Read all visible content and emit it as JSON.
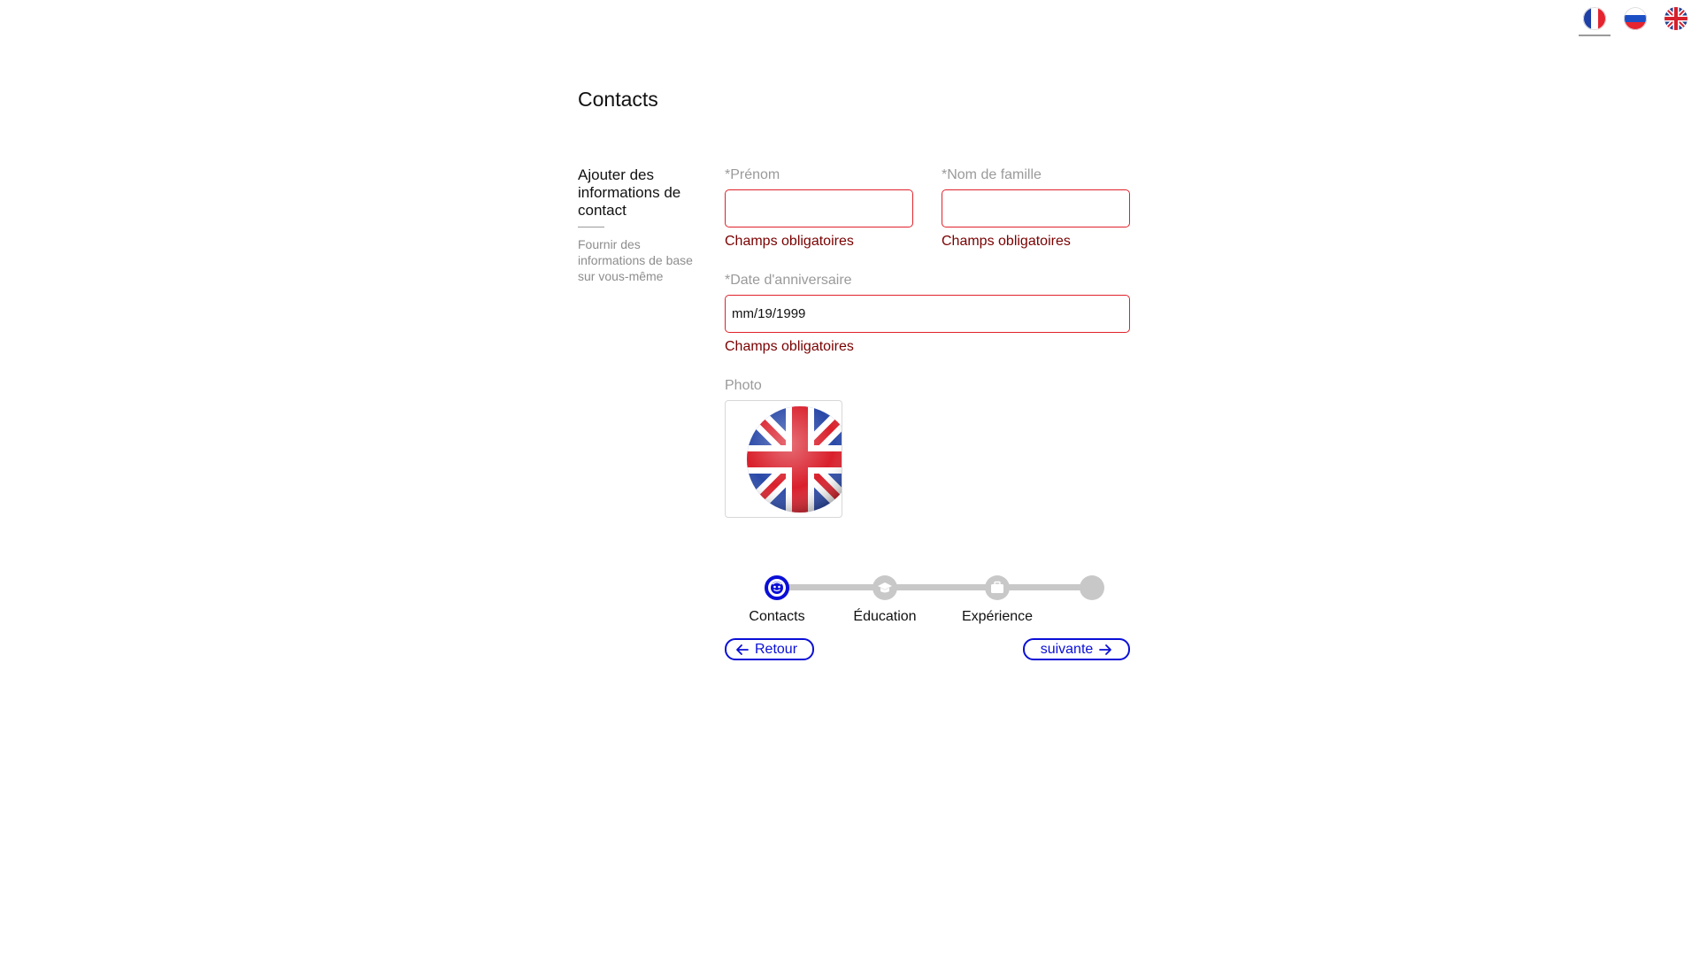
{
  "languages": [
    {
      "code": "fr",
      "icon": "france-flag-icon",
      "active": true
    },
    {
      "code": "ru",
      "icon": "russia-flag-icon",
      "active": false
    },
    {
      "code": "en",
      "icon": "uk-flag-icon",
      "active": false
    }
  ],
  "page": {
    "title": "Contacts"
  },
  "section": {
    "heading": "Ajouter des informations de contact",
    "description": "Fournir des informations de base sur vous-même"
  },
  "form": {
    "first_name": {
      "label": "*Prénom",
      "value": "",
      "error": "Champs obligatoires"
    },
    "last_name": {
      "label": "*Nom de famille",
      "value": "",
      "error": "Champs obligatoires"
    },
    "birthday": {
      "label": "*Date d'anniversaire",
      "value": "mm/19/1999",
      "error": "Champs obligatoires"
    },
    "photo": {
      "label": "Photo",
      "icon": "uk-flag-icon"
    }
  },
  "stepper": {
    "steps": [
      {
        "label": "Contacts",
        "icon": "user-face-icon",
        "active": true
      },
      {
        "label": "Éducation",
        "icon": "graduation-cap-icon",
        "active": false
      },
      {
        "label": "Expérience",
        "icon": "briefcase-icon",
        "active": false
      },
      {
        "label": "",
        "icon": "",
        "active": false
      }
    ]
  },
  "buttons": {
    "back": "Retour",
    "next": "suivante"
  },
  "colors": {
    "accent": "#0a0fd6",
    "error_border": "#e0222b",
    "error_text": "#7a0000",
    "muted": "#9a9a9a"
  }
}
